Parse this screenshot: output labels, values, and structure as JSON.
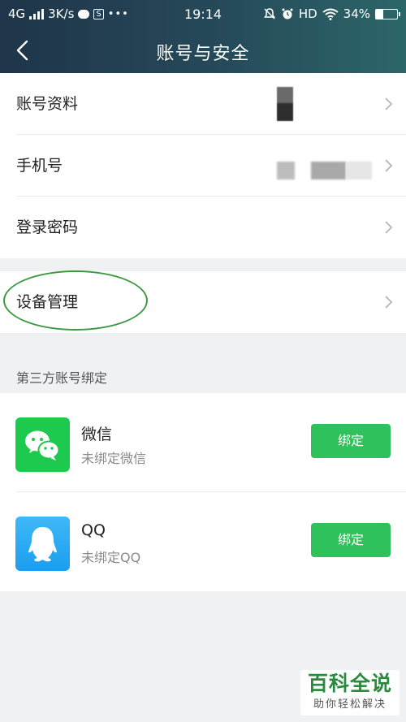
{
  "status_bar": {
    "network": "4G",
    "speed": "3K/s",
    "time": "19:14",
    "hd_label": "HD",
    "battery_text": "34%",
    "battery_level": 0.34,
    "s_icon_text": "S",
    "more_dots": "•••"
  },
  "header": {
    "title": "账号与安全",
    "back_icon": "back-chevron-icon"
  },
  "account_group": {
    "items": [
      {
        "label": "账号资料"
      },
      {
        "label": "手机号"
      },
      {
        "label": "登录密码"
      }
    ]
  },
  "device_group": {
    "label": "设备管理"
  },
  "third_party": {
    "section_title": "第三方账号绑定",
    "accounts": [
      {
        "name": "微信",
        "status": "未绑定微信",
        "button": "绑定",
        "icon": "wechat-icon"
      },
      {
        "name": "QQ",
        "status": "未绑定QQ",
        "button": "绑定",
        "icon": "qq-penguin-icon"
      }
    ]
  },
  "watermark": {
    "main": "百科全说",
    "sub": "助你轻松解决"
  },
  "colors": {
    "header_start": "#1f3549",
    "header_end": "#2c6669",
    "bind_button": "#2fc15c",
    "wechat": "#1eca4d",
    "qq": "#1b9ef0",
    "annotation": "#3b9a3f"
  }
}
